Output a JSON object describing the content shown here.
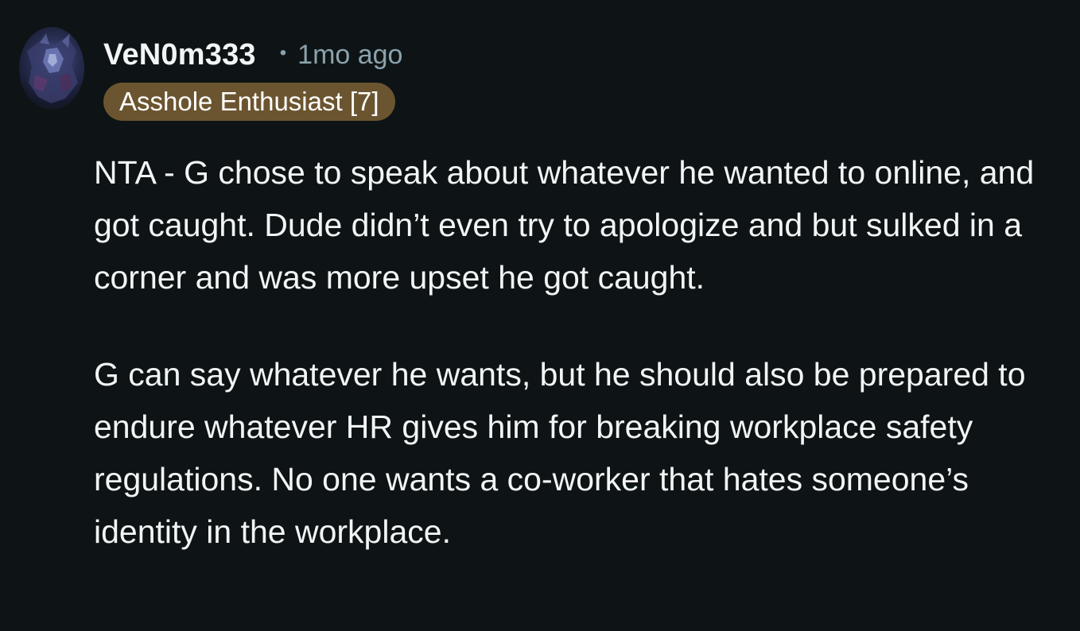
{
  "comment": {
    "author": "VeN0m333",
    "separator": "•",
    "timestamp": "1mo ago",
    "flair": "Asshole Enthusiast [7]",
    "paragraphs": [
      "NTA - G chose to speak about whatever he wanted to online, and got caught. Dude didn’t even try to apologize and but sulked in a corner and was more upset he got caught.",
      "G can say whatever he wants, but he should also be prepared to endure whatever HR gives him for breaking workplace safety regulations. No one wants a co-worker that hates someone’s identity in the workplace."
    ]
  },
  "colors": {
    "background": "#0e1415",
    "text": "#f2f4f5",
    "meta": "#8ba2ad",
    "flair_background": "#6b5530"
  },
  "icons": {
    "avatar": "user-avatar-image"
  }
}
